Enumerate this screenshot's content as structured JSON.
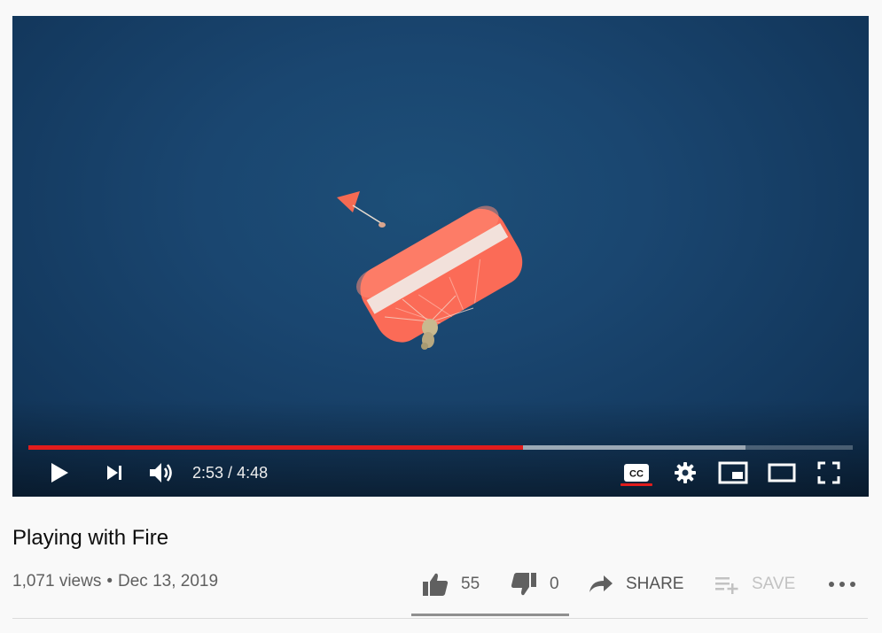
{
  "player": {
    "progress": {
      "played_fraction": 0.6,
      "loaded_fraction": 0.87
    },
    "time": {
      "current": "2:53",
      "duration": "4:48",
      "separator": " / "
    },
    "icons": {
      "play": "play-icon",
      "next": "next-icon",
      "volume": "volume-icon",
      "captions": "captions-icon",
      "settings": "gear-icon",
      "miniplayer": "miniplayer-icon",
      "theater": "theater-mode-icon",
      "fullscreen": "fullscreen-icon"
    },
    "colors": {
      "progress_played": "#e21c1c",
      "sky": "#1a4670",
      "canopy": "#fa6a55"
    }
  },
  "video": {
    "title": "Playing with Fire",
    "views": "1,071 views",
    "bullet": "•",
    "date": "Dec 13, 2019"
  },
  "actions": {
    "likes": "55",
    "dislikes": "0",
    "share_label": "SHARE",
    "save_label": "SAVE",
    "sentiment_like_fraction": 1.0
  }
}
